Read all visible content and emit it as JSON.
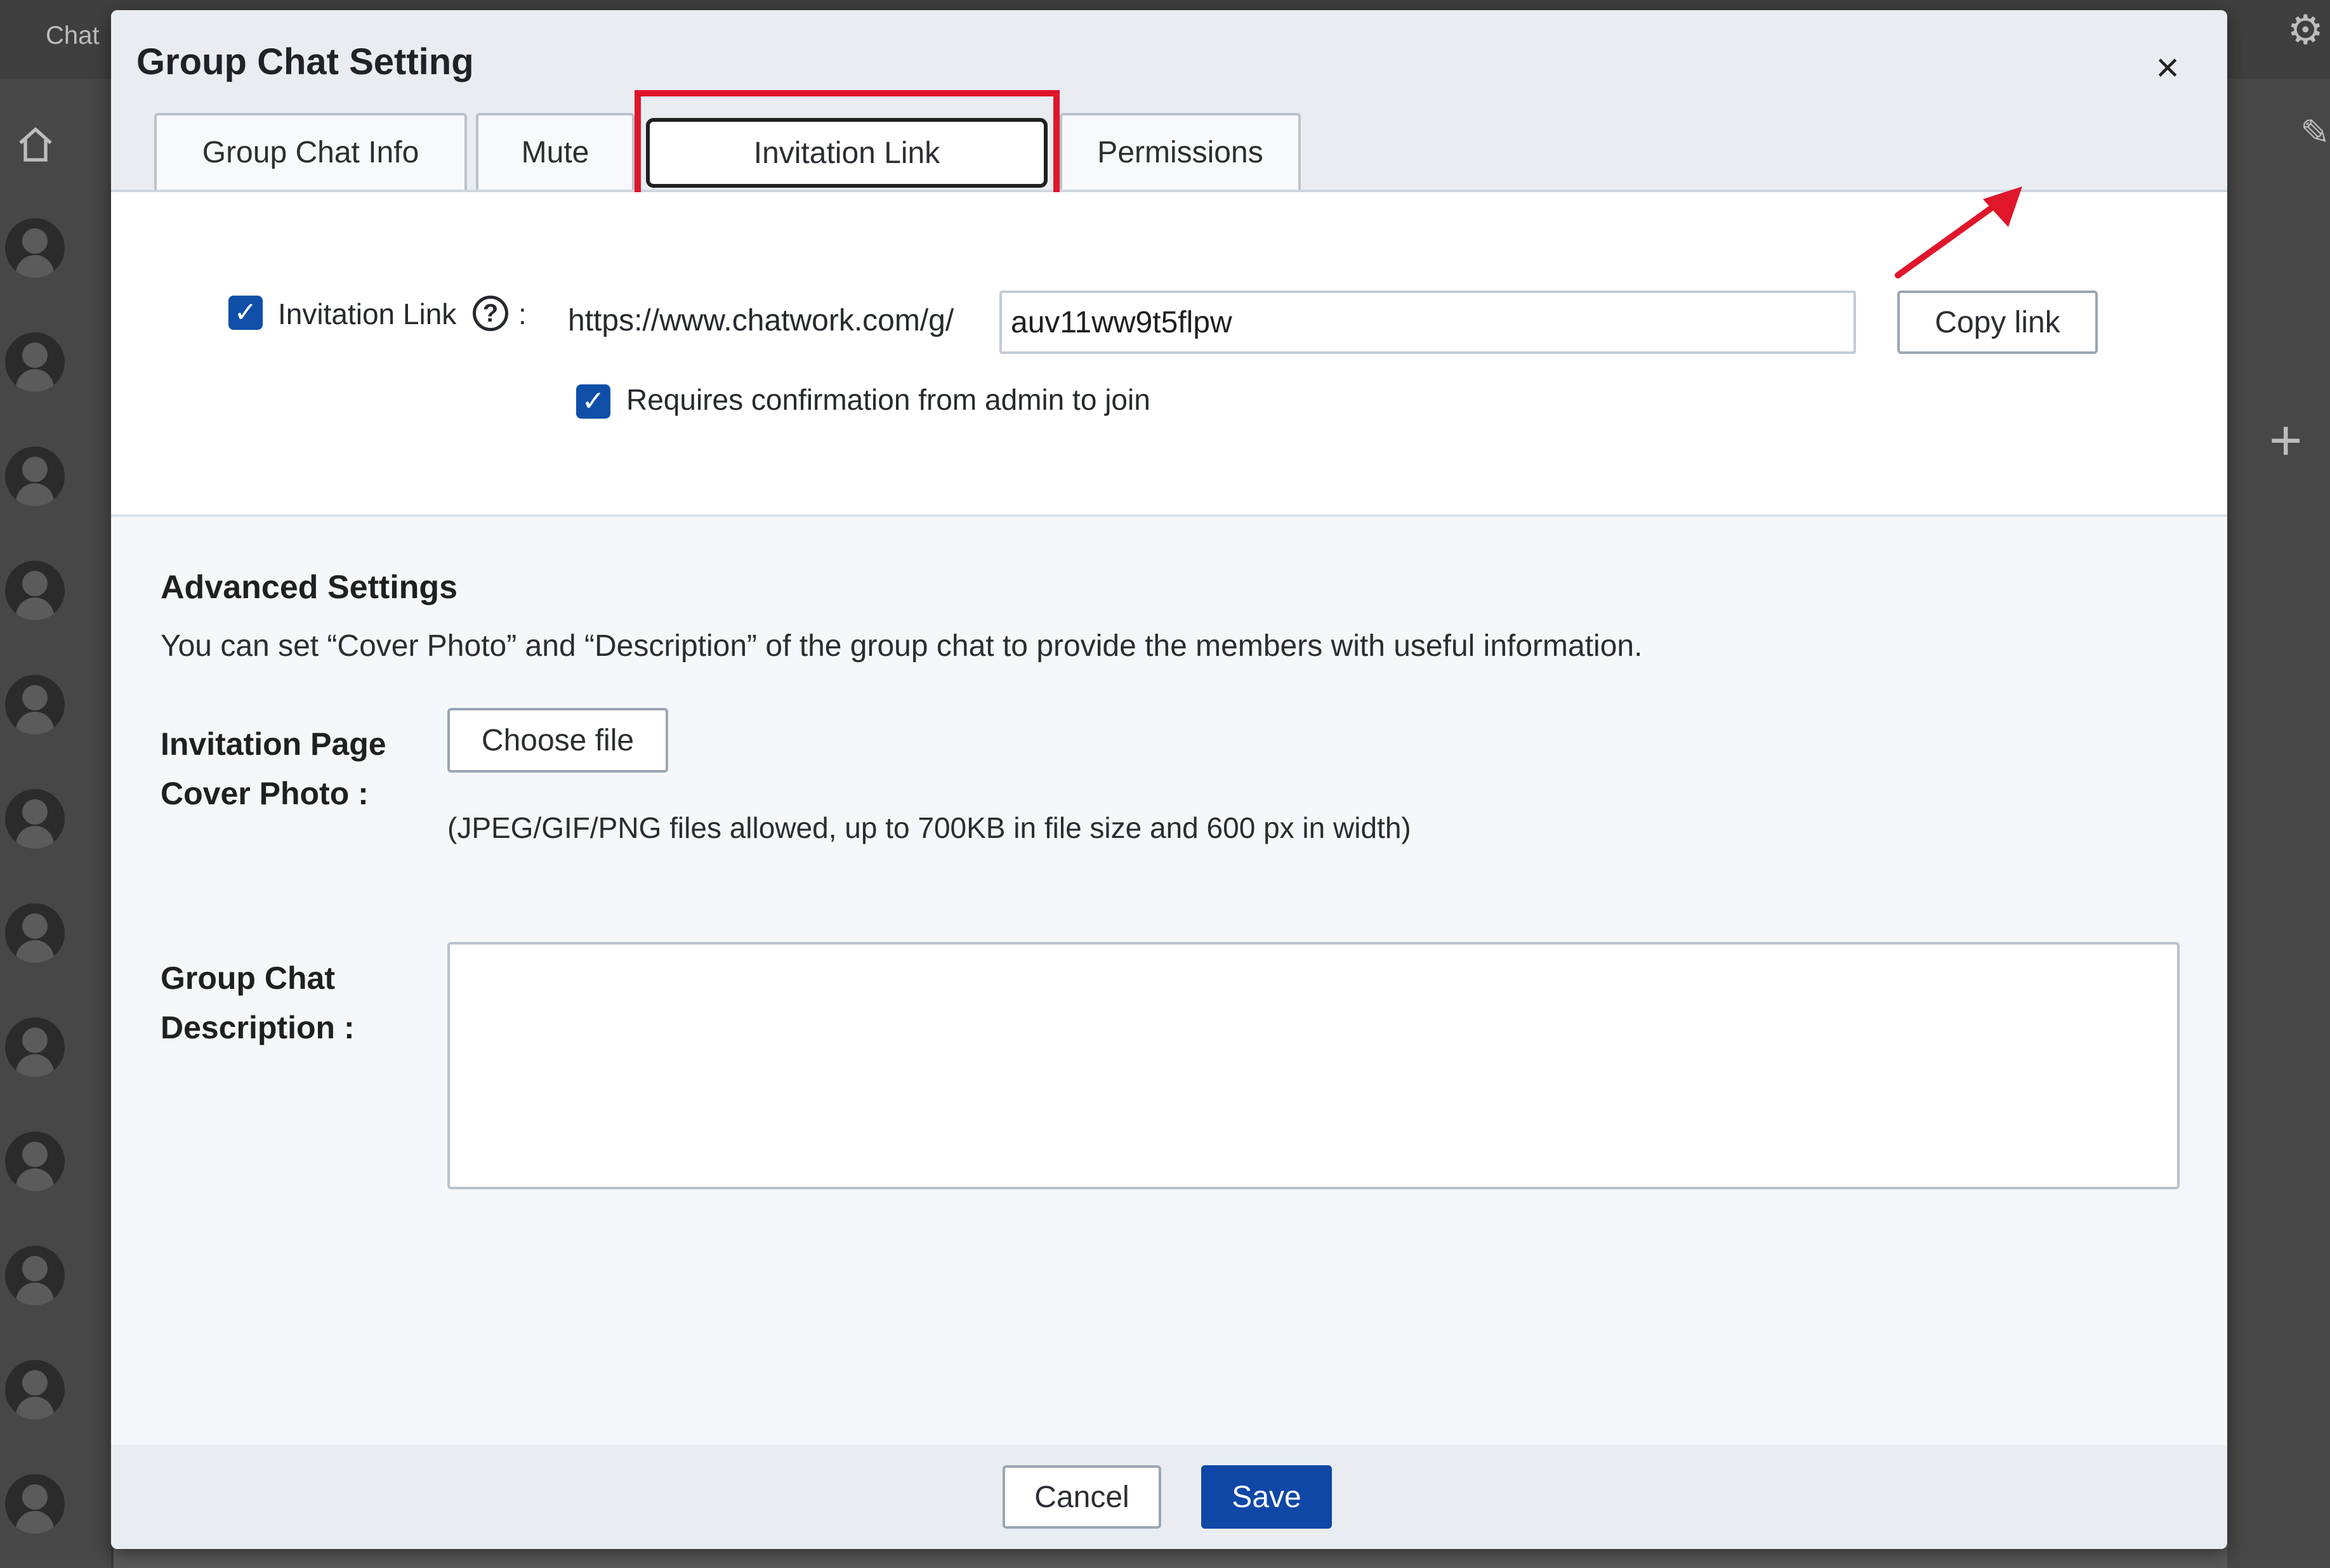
{
  "app": {
    "chat_label": "Chat"
  },
  "modal": {
    "title": "Group Chat Setting",
    "close_glyph": "×"
  },
  "tabs": [
    {
      "label": "Group Chat Info",
      "active": false
    },
    {
      "label": "Mute",
      "active": false
    },
    {
      "label": "Invitation Link",
      "active": true
    },
    {
      "label": "Permissions",
      "active": false
    }
  ],
  "invitation": {
    "enabled_checked": true,
    "label": "Invitation Link",
    "help_glyph": "?",
    "colon": ":",
    "url_prefix": "https://www.chatwork.com/g/",
    "link_value": "auv11ww9t5flpw",
    "copy_button": "Copy link",
    "confirm_checked": true,
    "confirm_label": "Requires confirmation from admin to join"
  },
  "advanced": {
    "title": "Advanced Settings",
    "description": "You can set “Cover Photo” and “Description” of the group chat to provide the members with useful information.",
    "cover_label_line1": "Invitation Page",
    "cover_label_line2": "Cover Photo :",
    "choose_file": "Choose file",
    "file_hint": "(JPEG/GIF/PNG files allowed, up to 700KB in file size and 600 px in width)",
    "desc_label_line1": "Group Chat",
    "desc_label_line2": "Description :",
    "desc_value": ""
  },
  "footer": {
    "cancel": "Cancel",
    "save": "Save"
  },
  "colors": {
    "primary": "#0f47a6",
    "highlight": "#e0162b"
  }
}
